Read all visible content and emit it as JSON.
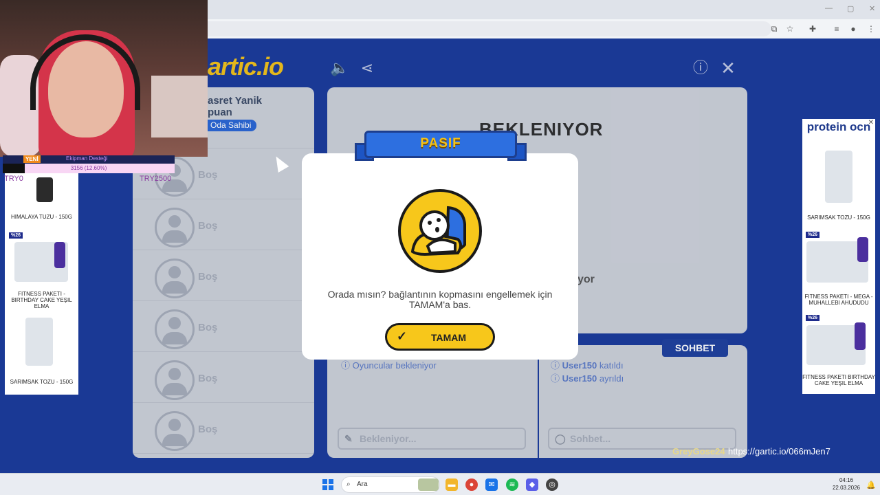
{
  "browser": {
    "toolbar_icons": [
      "cast-icon",
      "star-icon",
      "extension-icon",
      "media-icon",
      "profile-icon",
      "menu-icon"
    ]
  },
  "game": {
    "logo": "artic.io",
    "header_icons": [
      "sound-icon",
      "share-icon",
      "info-icon",
      "close-icon"
    ],
    "players": {
      "first": {
        "name": "asret Yanik",
        "points": "puan",
        "badge": "Oda Sahibi"
      },
      "empty_label": "Boş",
      "empty_slots": 6
    },
    "board": {
      "title": "BEKLENIYOR",
      "subtitle": "yor"
    },
    "answers_info": "Oyuncular bekleniyor",
    "answers_placeholder": "Bekleniyor...",
    "chat_tab": "SOHBET",
    "chat_events": [
      {
        "user": "User150",
        "action": "katıldı"
      },
      {
        "user": "User150",
        "action": "ayrıldı"
      }
    ],
    "chat_placeholder": "Sohbet..."
  },
  "modal": {
    "ribbon": "PASIF",
    "message": "Orada mısın? bağlantının kopmasını engellemek için TAMAM'a bas.",
    "button": "TAMAM"
  },
  "stream": {
    "donation": {
      "new_badge": "YENİ",
      "title": "Ekipman Desteği",
      "progress_text": "3156 (12.60%)",
      "progress_fraction": 0.126,
      "min": "TRY0",
      "max": "TRY2500"
    },
    "username": "GreyGose24",
    "link": "https://gartic.io/066mJen7"
  },
  "ads": {
    "left": [
      {
        "label": "HIMALAYA TUZU - 150G"
      },
      {
        "badge": "%26",
        "label": "FITNESS PAKETI - BIRTHDAY CAKE YEŞIL ELMA"
      },
      {
        "label": "SARIMSAK TOZU - 150G"
      }
    ],
    "right": {
      "brand": "protein ocn",
      "items": [
        {
          "label": "SARIMSAK TOZU - 150G"
        },
        {
          "badge": "%26",
          "label": "FITNESS PAKETI - MEGA - MUHALLEBI AHUDUDU"
        },
        {
          "badge": "%26",
          "label": "FITNESS PAKETI BIRTHDAY CAKE YEŞIL ELMA"
        }
      ]
    }
  },
  "taskbar": {
    "search": "Ara",
    "time": "04:16",
    "date": "22.03.2026"
  }
}
